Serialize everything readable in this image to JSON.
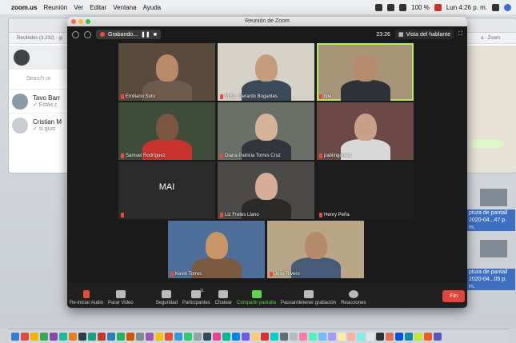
{
  "menubar": {
    "app": "zoom.us",
    "items": [
      "Reunión",
      "Ver",
      "Editar",
      "Ventana",
      "Ayuda"
    ],
    "battery": "100 %",
    "clock": "Lun 4:26 p. m."
  },
  "browser": {
    "tab_left": "Recibidos (3.232) · gi",
    "tab_right": "a · Zoom",
    "search_placeholder": "Search or",
    "chats": [
      {
        "name": "Tavo Barr",
        "msg": "✓ Estás c"
      },
      {
        "name": "Cristian M",
        "msg": "✓ si gust"
      }
    ]
  },
  "desktop_files": [
    {
      "label": "ptura de pantall 2020-04...47 p. m."
    },
    {
      "label": "ptura de pantall 2020-04...05 p. m."
    }
  ],
  "zoom": {
    "window_title": "Reunión de Zoom",
    "recording_label": "Grabando...",
    "timer": "23:26",
    "view_label": "Vista del hablante",
    "participants": [
      {
        "name": "Emiliano Soto",
        "bg": "#5a4a3c",
        "skin": "#b98a6a",
        "shirt": "#6d5a4a"
      },
      {
        "name": "M.Sc. Gerardo Bogantes",
        "bg": "#d6d2c8",
        "skin": "#c49b7c",
        "shirt": "#3b4a5a"
      },
      {
        "name": "lipe",
        "bg": "#a89478",
        "skin": "#b68a6c",
        "shirt": "#2e3138",
        "active": true
      },
      {
        "name": "Samuel Rodríguez",
        "bg": "#3d4d3a",
        "skin": "#7a5540",
        "shirt": "#c8322c"
      },
      {
        "name": "Diana Patricia Torres Cruz",
        "bg": "#6a7068",
        "skin": "#d7b39a",
        "shirt": "#32363c"
      },
      {
        "name": "pablingomez",
        "bg": "#6b4a45",
        "skin": "#c9a08a",
        "shirt": "#d8d8d8"
      },
      {
        "name": "",
        "text": "MAI",
        "bg": "#2b2b2b"
      },
      {
        "name": "Liz Fretes Llano",
        "bg": "#4b4a48",
        "skin": "#d7ad96",
        "shirt": "#2b2a29"
      },
      {
        "name": "Henry Peña",
        "bg": "#1e1e1e"
      },
      {
        "name": "Kevin Torres",
        "bg": "#4d6f99",
        "skin": "#c99466",
        "shirt": "#7a5a40"
      },
      {
        "name": "José Rivero",
        "bg": "#b9a588",
        "skin": "#b48a6c",
        "shirt": "#475a77"
      }
    ],
    "toolbar": {
      "mic": "Re-iniciar Audio",
      "video": "Parar Video",
      "security": "Seguridad",
      "participants": "Participantes",
      "participants_count": "11",
      "chat": "Chatear",
      "share": "Compartir pantalla",
      "record": "Pausar/detener grabación",
      "reactions": "Reacciones",
      "end": "Fin"
    }
  }
}
